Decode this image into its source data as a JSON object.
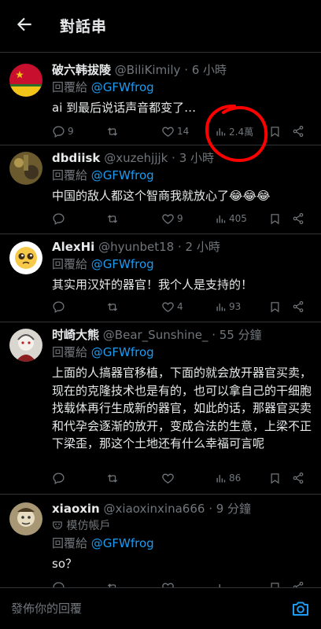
{
  "header": {
    "title": "對話串"
  },
  "tweets": [
    {
      "display_name": "破六韩拔陵",
      "handle": "@BiliKimily",
      "time": "· 6 小時",
      "reply_prefix": "回覆給",
      "reply_to": "@GFWfrog",
      "text": "ai 到最后说话声音都变了…",
      "stats": {
        "replies": "9",
        "retweets": "",
        "likes": "14",
        "views": "2.4萬"
      }
    },
    {
      "display_name": "dbdiisk",
      "handle": "@xuzehjjjk",
      "time": "· 3 小時",
      "reply_prefix": "回覆給",
      "reply_to": "@GFWfrog",
      "text": "中国的敌人都这个智商我就放心了😂😂😂",
      "stats": {
        "replies": "",
        "retweets": "",
        "likes": "9",
        "views": "405"
      }
    },
    {
      "display_name": "AlexHi",
      "handle": "@hyunbet18",
      "time": "· 2 小時",
      "reply_prefix": "回覆給",
      "reply_to": "@GFWfrog",
      "text": "其实用汉奸的器官！我个人是支持的！",
      "stats": {
        "replies": "",
        "retweets": "",
        "likes": "4",
        "views": "93"
      }
    },
    {
      "display_name": "时崎大熊",
      "handle": "@Bear_Sunshine_",
      "time": "· 55 分鐘",
      "reply_prefix": "回覆給",
      "reply_to": "@GFWfrog",
      "text": "上面的人搞器官移植，下面的就会放开器官买卖，现在的克隆技术也是有的，也可以拿自己的干细胞找载体再行生成新的器官，如此的话，那器官买卖和代孕会逐渐的放开，变成合法的生意，上梁不正下梁歪，那这个土地还有什么幸福可言呢",
      "stats": {
        "replies": "",
        "retweets": "",
        "likes": "",
        "views": "86"
      }
    },
    {
      "display_name": "xiaoxin",
      "handle": "@xiaoxinxina666",
      "time": "· 9 分鐘",
      "badge": "模仿帳戶",
      "reply_prefix": "回覆給",
      "reply_to": "@GFWfrog",
      "text": "so？",
      "stats": {
        "replies": "",
        "retweets": "",
        "likes": "",
        "views": ""
      }
    }
  ],
  "composer": {
    "placeholder": "發佈你的回覆"
  },
  "icons": {
    "back": "arrow-left-icon",
    "reply": "speech-bubble-icon",
    "retweet": "retweet-icon",
    "like": "heart-icon",
    "views": "bar-chart-icon",
    "bookmark": "bookmark-icon",
    "share": "share-icon",
    "camera": "camera-icon",
    "impersonation": "mask-icon"
  },
  "colors": {
    "accent": "#1d9bf0",
    "annotation": "#ff0000",
    "muted": "#71767b",
    "background": "#000000"
  }
}
